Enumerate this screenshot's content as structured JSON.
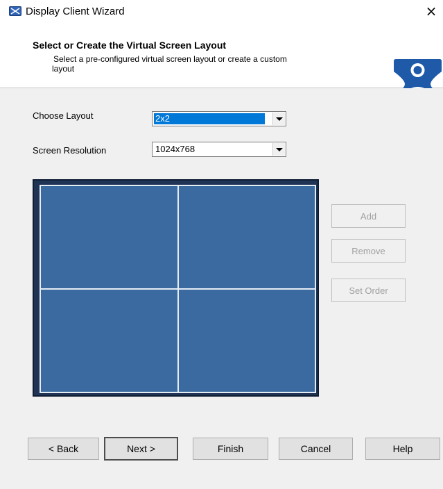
{
  "window": {
    "title": "Display Client Wizard",
    "close_glyph": "×"
  },
  "header": {
    "title": "Select or Create the Virtual Screen Layout",
    "subtitle_line1": "Select a pre-configured virtual screen layout or create a custom",
    "subtitle_line2": "layout"
  },
  "form": {
    "layout_label": "Choose Layout",
    "layout_value": "2x2",
    "resolution_label": "Screen Resolution",
    "resolution_value": "1024x768"
  },
  "layout_grid": {
    "rows": 2,
    "columns": 2
  },
  "side_buttons": {
    "add": "Add",
    "remove": "Remove",
    "set_order": "Set Order"
  },
  "footer": {
    "back": "< Back",
    "next": "Next >",
    "finish": "Finish",
    "cancel": "Cancel",
    "help": "Help"
  },
  "colors": {
    "screen_fill": "#3a6aa0",
    "preview_frame": "#1f3354",
    "selection": "#0078d7",
    "brand_blue": "#1e5aa8"
  },
  "icons": {
    "app": "display-client-icon",
    "brand": "thinmanager-logo-icon",
    "close": "close-icon"
  }
}
